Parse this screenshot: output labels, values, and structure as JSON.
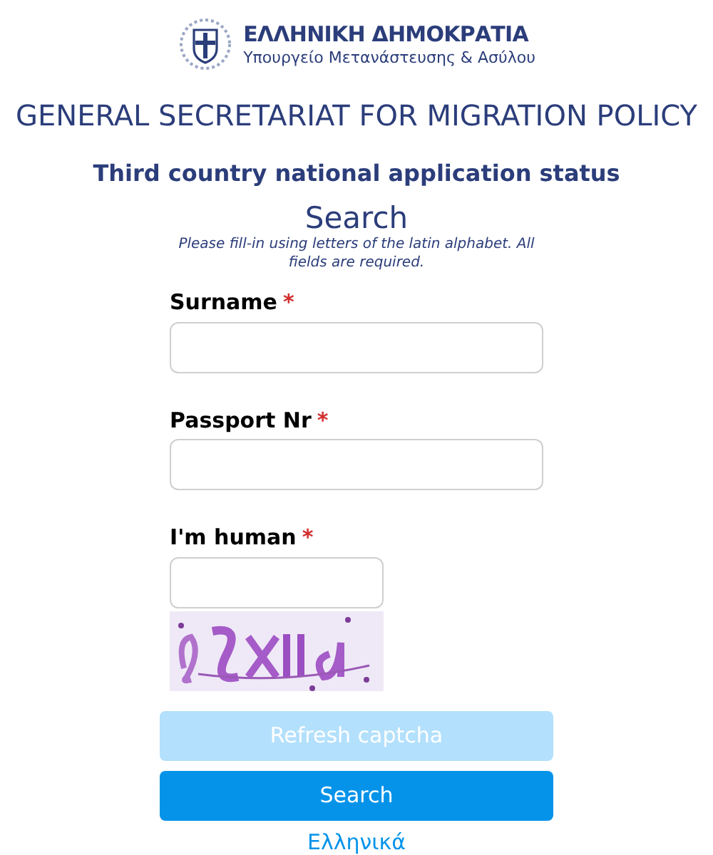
{
  "header": {
    "org_name": "ΕΛΛΗΝΙΚΗ ΔΗΜΟΚΡΑΤΙΑ",
    "ministry": "Υπουργείο Μετανάστευσης & Ασύλου"
  },
  "title": "GENERAL SECRETARIAT FOR MIGRATION POLICY",
  "subtitle": "Third country national application status",
  "form": {
    "heading": "Search",
    "note": "Please fill-in using letters of the latin alphabet. All fields are required.",
    "fields": [
      {
        "label": "Surname",
        "required_mark": "*",
        "kind": "text"
      },
      {
        "label": "Passport Nr",
        "required_mark": "*",
        "kind": "text"
      },
      {
        "label": "I'm human",
        "required_mark": "*",
        "kind": "captcha"
      }
    ],
    "buttons": [
      {
        "label": "Refresh captcha",
        "disabled": true
      },
      {
        "label": "Search",
        "disabled": false
      }
    ],
    "language_link": "Ελληνικά"
  }
}
